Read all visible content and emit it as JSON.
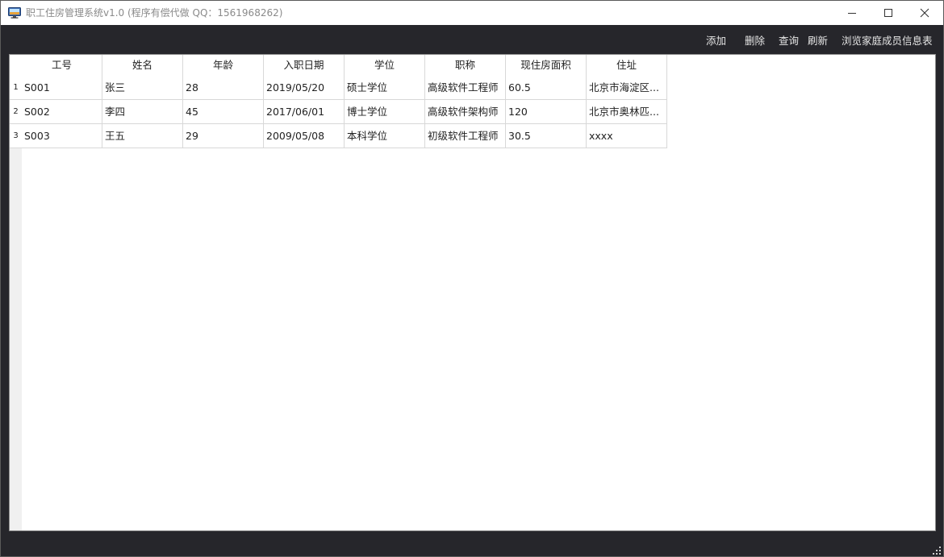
{
  "window": {
    "title": "职工住房管理系统v1.0 (程序有偿代做 QQ：1561968262)"
  },
  "toolbar": {
    "add_label": "添加",
    "delete_label": "删除",
    "query_label": "查询",
    "refresh_label": "刷新",
    "family_label": "浏览家庭成员信息表"
  },
  "table": {
    "columns": [
      "工号",
      "姓名",
      "年龄",
      "入职日期",
      "学位",
      "职称",
      "现住房面积",
      "住址"
    ],
    "row_numbers": [
      "1",
      "2",
      "3"
    ],
    "rows": [
      [
        "S001",
        "张三",
        "28",
        "2019/05/20",
        "硕士学位",
        "高级软件工程师",
        "60.5",
        "北京市海淀区..."
      ],
      [
        "S002",
        "李四",
        "45",
        "2017/06/01",
        "博士学位",
        "高级软件架构师",
        "120",
        "北京市奥林匹..."
      ],
      [
        "S003",
        "王五",
        "29",
        "2009/05/08",
        "本科学位",
        "初级软件工程师",
        "30.5",
        "xxxx"
      ]
    ]
  },
  "icons": {
    "app": "monitor-icon",
    "minimize": "minimize-icon",
    "maximize": "maximize-icon",
    "close": "close-icon"
  },
  "colors": {
    "dark_background": "#26262b",
    "toolbar_text": "#e6e6e6",
    "title_text": "#8a8a8a",
    "grid_line": "#d8d8d8",
    "row_gutter": "#f0f0f0"
  }
}
